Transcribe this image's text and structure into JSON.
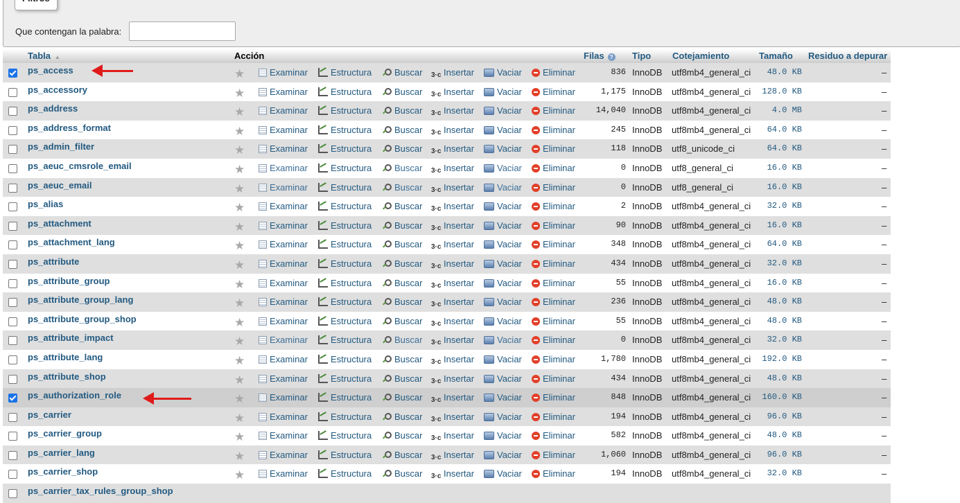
{
  "filters": {
    "legend": "Filtros",
    "label": "Que contengan la palabra:",
    "input_value": "",
    "input_placeholder": ""
  },
  "header": {
    "tabla": "Tabla",
    "accion": "Acción",
    "filas": "Filas",
    "tipo": "Tipo",
    "cotejamiento": "Cotejamiento",
    "tamano": "Tamaño",
    "residuo": "Residuo a depurar"
  },
  "actions": {
    "examinar": "Examinar",
    "estructura": "Estructura",
    "buscar": "Buscar",
    "insertar": "Insertar",
    "vaciar": "Vaciar",
    "eliminar": "Eliminar"
  },
  "overhead_placeholder": "–",
  "rows": [
    {
      "name": "ps_access",
      "checked": true,
      "rows": "836",
      "type": "InnoDB",
      "collation": "utf8mb4_general_ci",
      "size": "48.0 KB"
    },
    {
      "name": "ps_accessory",
      "checked": false,
      "rows": "1,175",
      "type": "InnoDB",
      "collation": "utf8mb4_general_ci",
      "size": "128.0 KB"
    },
    {
      "name": "ps_address",
      "checked": false,
      "rows": "14,040",
      "type": "InnoDB",
      "collation": "utf8mb4_general_ci",
      "size": "4.0 MB"
    },
    {
      "name": "ps_address_format",
      "checked": false,
      "rows": "245",
      "type": "InnoDB",
      "collation": "utf8mb4_general_ci",
      "size": "64.0 KB"
    },
    {
      "name": "ps_admin_filter",
      "checked": false,
      "rows": "118",
      "type": "InnoDB",
      "collation": "utf8_unicode_ci",
      "size": "64.0 KB"
    },
    {
      "name": "ps_aeuc_cmsrole_email",
      "checked": false,
      "rows": "0",
      "type": "InnoDB",
      "collation": "utf8_general_ci",
      "size": "16.0 KB"
    },
    {
      "name": "ps_aeuc_email",
      "checked": false,
      "rows": "0",
      "type": "InnoDB",
      "collation": "utf8_general_ci",
      "size": "16.0 KB"
    },
    {
      "name": "ps_alias",
      "checked": false,
      "rows": "2",
      "type": "InnoDB",
      "collation": "utf8mb4_general_ci",
      "size": "32.0 KB"
    },
    {
      "name": "ps_attachment",
      "checked": false,
      "rows": "90",
      "type": "InnoDB",
      "collation": "utf8mb4_general_ci",
      "size": "16.0 KB"
    },
    {
      "name": "ps_attachment_lang",
      "checked": false,
      "rows": "348",
      "type": "InnoDB",
      "collation": "utf8mb4_general_ci",
      "size": "64.0 KB"
    },
    {
      "name": "ps_attribute",
      "checked": false,
      "rows": "434",
      "type": "InnoDB",
      "collation": "utf8mb4_general_ci",
      "size": "32.0 KB"
    },
    {
      "name": "ps_attribute_group",
      "checked": false,
      "rows": "55",
      "type": "InnoDB",
      "collation": "utf8mb4_general_ci",
      "size": "16.0 KB"
    },
    {
      "name": "ps_attribute_group_lang",
      "checked": false,
      "rows": "236",
      "type": "InnoDB",
      "collation": "utf8mb4_general_ci",
      "size": "48.0 KB"
    },
    {
      "name": "ps_attribute_group_shop",
      "checked": false,
      "rows": "55",
      "type": "InnoDB",
      "collation": "utf8mb4_general_ci",
      "size": "48.0 KB"
    },
    {
      "name": "ps_attribute_impact",
      "checked": false,
      "rows": "0",
      "type": "InnoDB",
      "collation": "utf8mb4_general_ci",
      "size": "32.0 KB"
    },
    {
      "name": "ps_attribute_lang",
      "checked": false,
      "rows": "1,780",
      "type": "InnoDB",
      "collation": "utf8mb4_general_ci",
      "size": "192.0 KB"
    },
    {
      "name": "ps_attribute_shop",
      "checked": false,
      "rows": "434",
      "type": "InnoDB",
      "collation": "utf8mb4_general_ci",
      "size": "48.0 KB"
    },
    {
      "name": "ps_authorization_role",
      "checked": true,
      "rows": "848",
      "type": "InnoDB",
      "collation": "utf8mb4_general_ci",
      "size": "160.0 KB"
    },
    {
      "name": "ps_carrier",
      "checked": false,
      "rows": "194",
      "type": "InnoDB",
      "collation": "utf8mb4_general_ci",
      "size": "96.0 KB"
    },
    {
      "name": "ps_carrier_group",
      "checked": false,
      "rows": "582",
      "type": "InnoDB",
      "collation": "utf8mb4_general_ci",
      "size": "48.0 KB"
    },
    {
      "name": "ps_carrier_lang",
      "checked": false,
      "rows": "1,060",
      "type": "InnoDB",
      "collation": "utf8mb4_general_ci",
      "size": "96.0 KB"
    },
    {
      "name": "ps_carrier_shop",
      "checked": false,
      "rows": "194",
      "type": "InnoDB",
      "collation": "utf8mb4_general_ci",
      "size": "32.0 KB"
    },
    {
      "name": "ps_carrier_tax_rules_group_shop",
      "checked": false,
      "rows": "",
      "type": "",
      "collation": "",
      "size": ""
    }
  ]
}
